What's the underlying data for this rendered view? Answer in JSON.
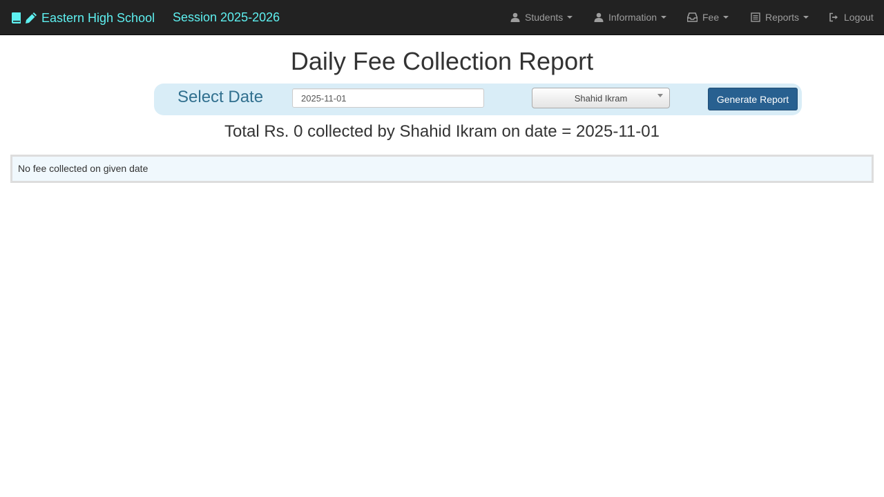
{
  "navbar": {
    "brand": "Eastern High School",
    "session": "Session 2025-2026",
    "brand_color": "#5ef0f0",
    "items": [
      {
        "label": "Students",
        "icon": "user-icon",
        "dropdown": true
      },
      {
        "label": "Information",
        "icon": "user-icon",
        "dropdown": true
      },
      {
        "label": "Fee",
        "icon": "inbox-icon",
        "dropdown": true
      },
      {
        "label": "Reports",
        "icon": "list-alt-icon",
        "dropdown": true
      },
      {
        "label": "Logout",
        "icon": "log-out-icon",
        "dropdown": false
      }
    ]
  },
  "page": {
    "title": "Daily Fee Collection Report"
  },
  "filter": {
    "label": "Select Date",
    "date_value": "2025-11-01",
    "collector_selected": "Shahid Ikram",
    "generate_label": "Generate Report",
    "panel_color": "#d9edf7",
    "button_color": "#286090"
  },
  "summary": {
    "text": "Total Rs. 0 collected by Shahid Ikram on date = 2025-11-01"
  },
  "result": {
    "message": "No fee collected on given date"
  }
}
